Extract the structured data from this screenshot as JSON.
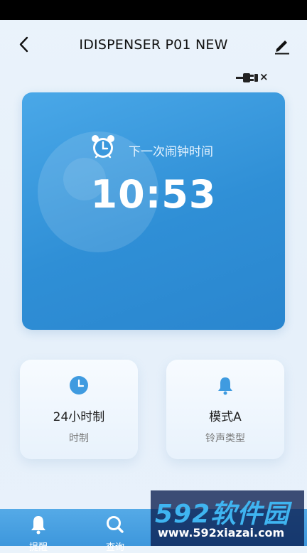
{
  "header": {
    "title": "IDISPENSER P01 NEW",
    "back_icon": "chevron-left-icon",
    "edit_icon": "pencil-icon"
  },
  "connection": {
    "icon": "plug-disconnected-icon",
    "status_mark": "×"
  },
  "alarm": {
    "label": "下一次闹钟时间",
    "time": "10:53",
    "icon": "alarm-clock-icon"
  },
  "settings": [
    {
      "value": "24小时制",
      "label": "时制",
      "icon": "clock-icon"
    },
    {
      "value": "模式A",
      "label": "铃声类型",
      "icon": "bell-icon"
    }
  ],
  "nav": {
    "items": [
      {
        "label": "提醒",
        "icon": "bell-icon"
      },
      {
        "label": "查询",
        "icon": "search-icon"
      }
    ]
  },
  "watermark": {
    "brand": "592软件园",
    "url": "www.592xiazai.com"
  },
  "colors": {
    "primary": "#3d97dc",
    "card_blue": "#2f8fd6"
  }
}
